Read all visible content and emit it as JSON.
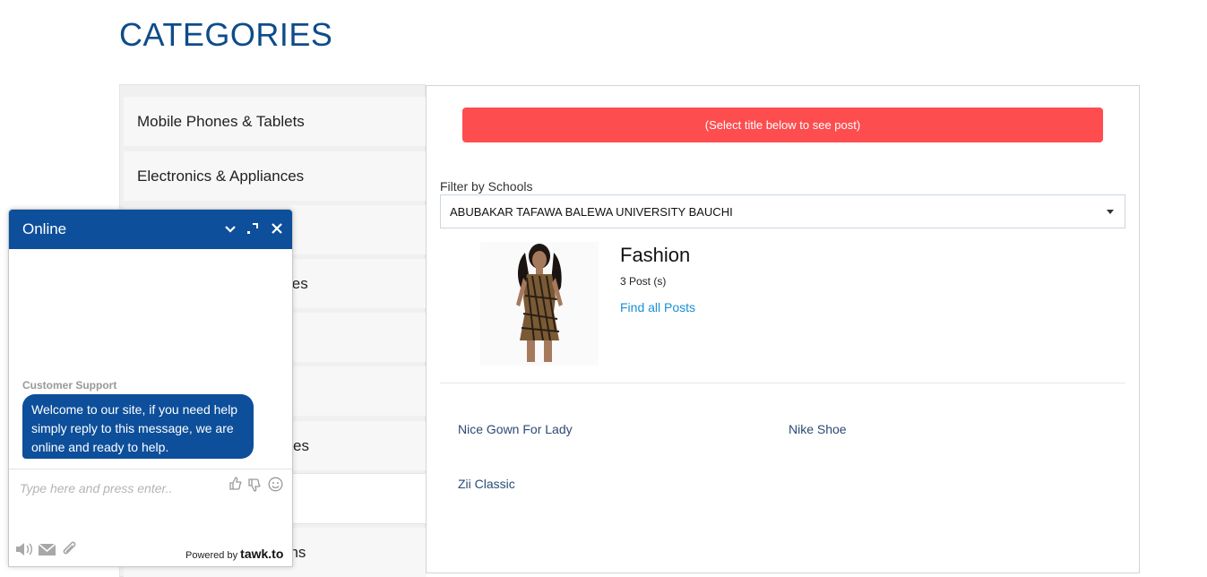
{
  "page": {
    "title": "CATEGORIES"
  },
  "categories": {
    "items": [
      {
        "label": "Mobile Phones & Tablets"
      },
      {
        "label": "Electronics & Appliances"
      },
      {
        "label": ""
      },
      {
        "label": "ies"
      },
      {
        "label": ""
      },
      {
        "label": ""
      },
      {
        "label": "es"
      }
    ],
    "bottom_item": {
      "label": "ons"
    }
  },
  "content": {
    "banner": "(Select title below to see post)",
    "filter_label": "Filter by Schools",
    "school_selected": "ABUBAKAR TAFAWA BALEWA UNIVERSITY BAUCHI",
    "category": {
      "name": "Fashion",
      "post_count": "3 Post (s)",
      "find_link": "Find all Posts"
    },
    "posts": [
      {
        "title": "Nice Gown For Lady"
      },
      {
        "title": "Nike Shoe"
      },
      {
        "title": "Zii Classic"
      }
    ]
  },
  "chat": {
    "status": "Online",
    "agent": "Customer Support",
    "message": "Welcome to our site, if you need help simply reply to this message, we are online and ready to help.",
    "input_placeholder": "Type here and press enter..",
    "powered_prefix": "Powered by",
    "powered_brand": "tawk.to",
    "icons": [
      "chevron-down-icon",
      "expand-icon",
      "close-icon",
      "thumbs-up-icon",
      "thumbs-down-icon",
      "emoji-icon",
      "sound-icon",
      "email-icon",
      "attachment-icon"
    ]
  },
  "colors": {
    "title_blue": "#0e4c8a",
    "banner_red": "#fd4d4f",
    "chat_blue": "#0d4f9b",
    "link_blue": "#1a8fd3"
  }
}
